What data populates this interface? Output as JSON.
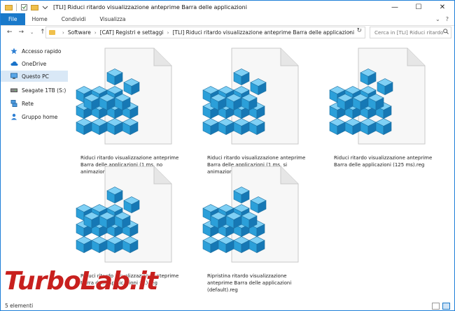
{
  "window": {
    "title": "[TLI] Riduci ritardo visualizzazione anteprime Barra delle applicazioni",
    "controls": {
      "minimize": "—",
      "maximize": "☐",
      "close": "✕"
    }
  },
  "ribbon": {
    "tabs": [
      "File",
      "Home",
      "Condividi",
      "Visualizza"
    ],
    "help_glyph": "?"
  },
  "address_bar": {
    "breadcrumbs": [
      "Software",
      "[CAT] Registri e settaggi",
      "[TLI] Riduci ritardo visualizzazione anteprime Barra delle applicazioni"
    ]
  },
  "search": {
    "placeholder": "Cerca in [TLI] Riduci ritardo..."
  },
  "nav_pane": {
    "items": [
      {
        "label": "Accesso rapido",
        "icon": "star-icon",
        "selected": false
      },
      {
        "label": "OneDrive",
        "icon": "cloud-icon",
        "selected": false
      },
      {
        "label": "Questo PC",
        "icon": "computer-icon",
        "selected": true
      },
      {
        "label": "Seagate 1TB (S:)",
        "icon": "drive-icon",
        "selected": false
      },
      {
        "label": "Rete",
        "icon": "network-icon",
        "selected": false
      },
      {
        "label": "Gruppo home",
        "icon": "homegroup-icon",
        "selected": false
      }
    ]
  },
  "files": [
    {
      "name": "Riduci ritardo visualizzazione anteprime Barra delle applicazioni (1 ms, no animazione).reg",
      "icon": "registry-file-icon"
    },
    {
      "name": "Riduci ritardo visualizzazione anteprime Barra delle applicazioni (1 ms, si animazione).reg",
      "icon": "registry-file-icon"
    },
    {
      "name": "Riduci ritardo visualizzazione anteprime Barra delle applicazioni (125 ms).reg",
      "icon": "registry-file-icon"
    },
    {
      "name": "Riduci ritardo visualizzazione anteprime Barra delle applicazioni (...).reg",
      "icon": "registry-file-icon"
    },
    {
      "name": "Ripristina ritardo visualizzazione anteprime Barra delle applicazioni (default).reg",
      "icon": "registry-file-icon"
    }
  ],
  "status_bar": {
    "count": "5 elementi"
  },
  "watermark": {
    "text": "TurboLab.it"
  },
  "colors": {
    "accent": "#1979ca",
    "selection": "#d9e8f6",
    "registry_cube": "#2b9fd9",
    "watermark_red": "#c8201e"
  }
}
